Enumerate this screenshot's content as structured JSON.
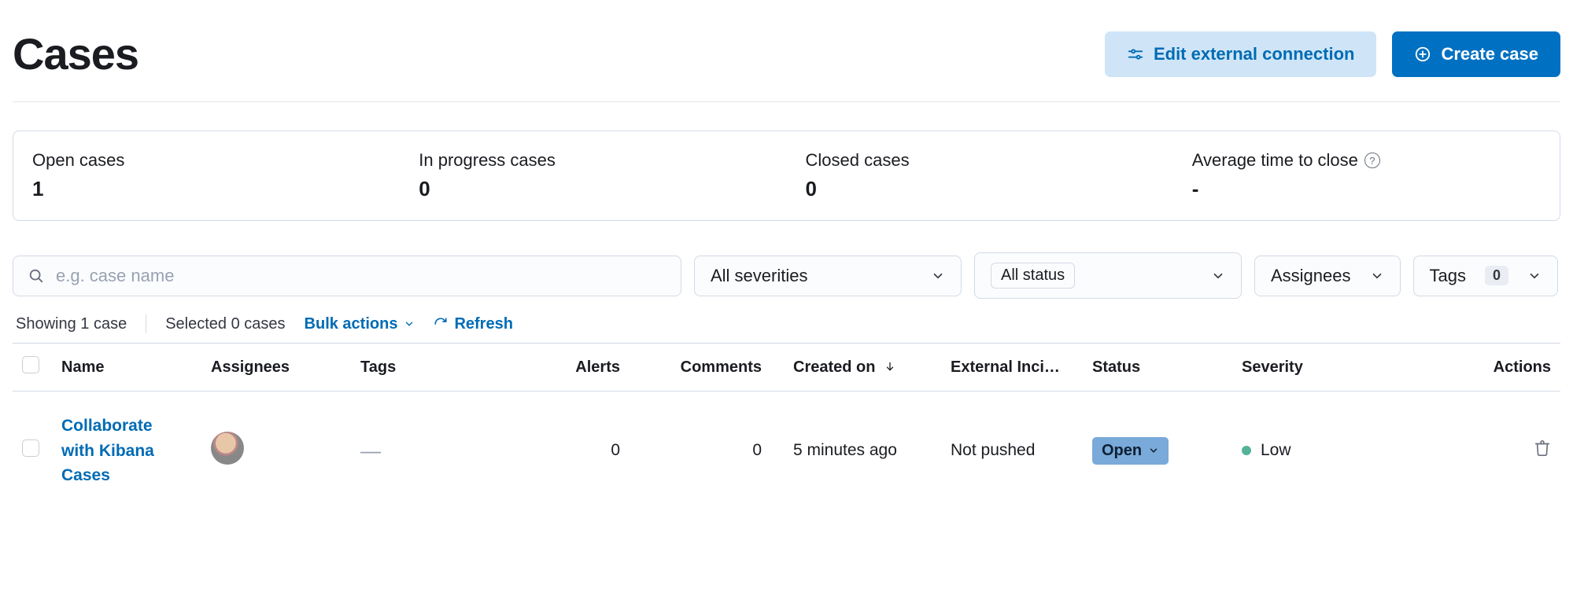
{
  "header": {
    "title": "Cases",
    "edit_connection_label": "Edit external connection",
    "create_case_label": "Create case"
  },
  "stats": {
    "open": {
      "label": "Open cases",
      "value": "1"
    },
    "in_progress": {
      "label": "In progress cases",
      "value": "0"
    },
    "closed": {
      "label": "Closed cases",
      "value": "0"
    },
    "avg_close": {
      "label": "Average time to close",
      "value": "-"
    }
  },
  "filters": {
    "search_placeholder": "e.g. case name",
    "severity_label": "All severities",
    "status_label": "All status",
    "assignees_label": "Assignees",
    "tags_label": "Tags",
    "tags_count": "0"
  },
  "meta": {
    "showing": "Showing 1 case",
    "selected": "Selected 0 cases",
    "bulk_actions": "Bulk actions",
    "refresh": "Refresh"
  },
  "columns": {
    "name": "Name",
    "assignees": "Assignees",
    "tags": "Tags",
    "alerts": "Alerts",
    "comments": "Comments",
    "created_on": "Created on",
    "external": "External Inci…",
    "status": "Status",
    "severity": "Severity",
    "actions": "Actions"
  },
  "rows": [
    {
      "name": "Collaborate with Kibana Cases",
      "tags": "—",
      "alerts": "0",
      "comments": "0",
      "created_on": "5 minutes ago",
      "external": "Not pushed",
      "status": "Open",
      "severity": "Low"
    }
  ]
}
